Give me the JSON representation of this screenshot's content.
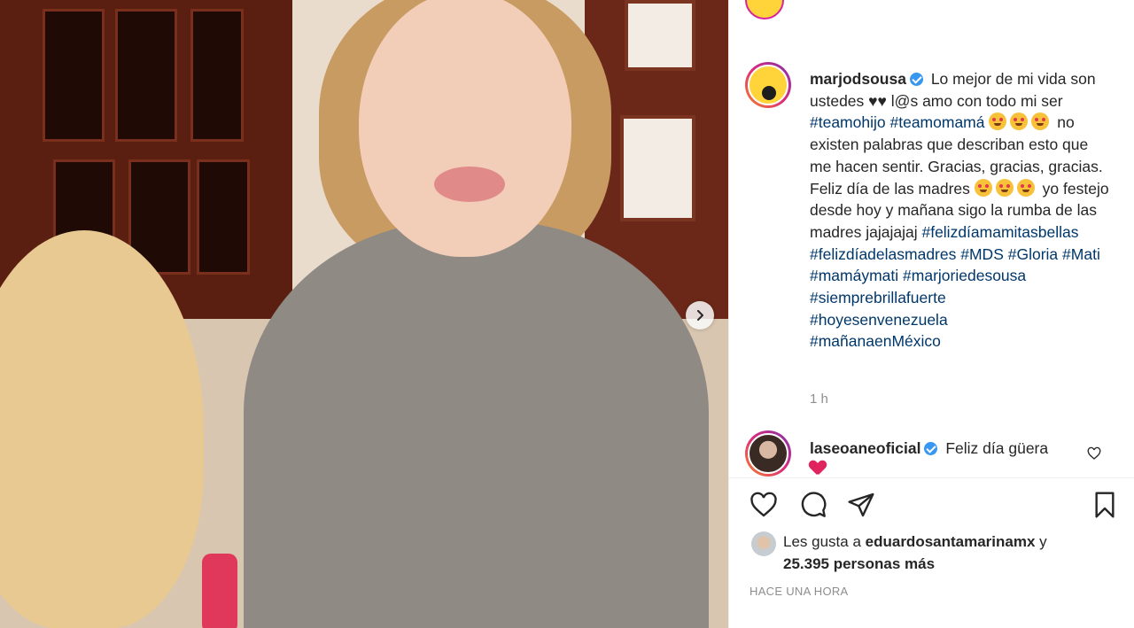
{
  "post": {
    "author": "marjodsousa",
    "caption_intro": "Lo mejor de mi vida son ustedes ♥♥ l@s amo con todo mi ser",
    "caption_tags_1": [
      "#teamohijo",
      "#teamomamá"
    ],
    "caption_mid": "no existen palabras que describan esto que me hacen sentir. Gracias, gracias, gracias. Feliz día de las madres",
    "caption_mid_2": "yo festejo desde hoy y mañana sigo la rumba de las madres jajajajaj",
    "caption_tags_2": [
      "#felizdíamamitasbellas",
      "#felizdíadelasmadres",
      "#MDS",
      "#Gloria",
      "#Mati",
      "#mamáymati",
      "#marjoriedesousa",
      "#siemprebrillafuerte",
      "#hoyesenvenezuela",
      "#mañanaenMéxico"
    ],
    "time": "1 h"
  },
  "comment": {
    "author": "laseoaneoficial",
    "text": "Feliz día güera"
  },
  "likes": {
    "prefix": "Les gusta a",
    "user": "eduardosantamarinamx",
    "joiner": "y",
    "count_text": "25.395 personas más"
  },
  "posted_ago": "HACE UNA HORA",
  "icons": {
    "like": "heart-icon",
    "comment": "comment-icon",
    "share": "paper-plane-icon",
    "save": "bookmark-icon",
    "next": "chevron-right-icon"
  },
  "colors": {
    "hashtag": "#00376b",
    "verified": "#3897f0",
    "muted": "#8e8e8e"
  }
}
